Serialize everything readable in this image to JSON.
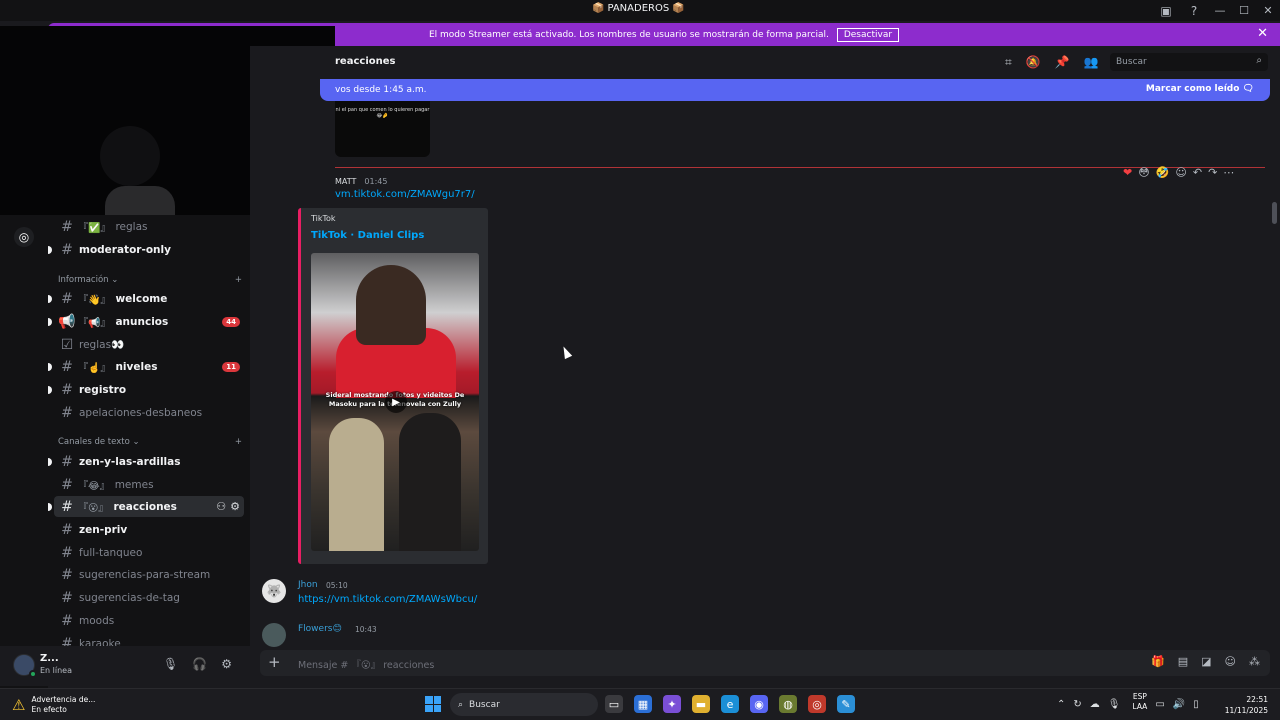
{
  "titlebar": {
    "server_name": "PANADEROS",
    "server_prefix": "📦",
    "server_suffix": "📦",
    "minimize": "—",
    "maximize": "☐",
    "close": "✕"
  },
  "streamer_banner": {
    "text": "El modo Streamer está activado. Los nombres de usuario se mostrarán de forma parcial.",
    "button": "Desactivar"
  },
  "sidebar": {
    "channels_top": [
      {
        "deco": "『✅』",
        "name": "reglas",
        "bold": false
      },
      {
        "deco": "",
        "name": "moderator-only",
        "bold": true
      }
    ],
    "category_info": "Información",
    "info_channels": [
      {
        "deco": "『👋』",
        "name": "welcome",
        "bold": true,
        "badge": ""
      },
      {
        "deco": "『📢』",
        "name": "anuncios",
        "bold": true,
        "badge": "44"
      },
      {
        "deco": "",
        "name": "reglas👀",
        "bold": false,
        "badge": ""
      },
      {
        "deco": "『☝️』",
        "name": "niveles",
        "bold": true,
        "badge": "11"
      },
      {
        "deco": "",
        "name": "registro",
        "bold": true,
        "badge": ""
      },
      {
        "deco": "",
        "name": "apelaciones-desbaneos",
        "bold": false,
        "badge": ""
      }
    ],
    "category_text": "Canales de texto",
    "text_channels": [
      {
        "deco": "",
        "name": "zen-y-las-ardillas",
        "bold": true
      },
      {
        "deco": "『😂』",
        "name": "memes",
        "bold": false
      },
      {
        "deco": "『😮』",
        "name": "reacciones",
        "bold": true,
        "active": true
      },
      {
        "deco": "",
        "name": "zen-priv",
        "bold": true
      },
      {
        "deco": "",
        "name": "full-tanqueo",
        "bold": false
      },
      {
        "deco": "",
        "name": "sugerencias-para-stream",
        "bold": false
      },
      {
        "deco": "",
        "name": "sugerencias-de-tag",
        "bold": false
      },
      {
        "deco": "",
        "name": "moods",
        "bold": false
      },
      {
        "deco": "",
        "name": "karaoke",
        "bold": false
      }
    ]
  },
  "user": {
    "name": "Z...",
    "status": "En línea"
  },
  "header": {
    "channel_title": "reacciones",
    "search_placeholder": "Buscar"
  },
  "new_messages": {
    "text": "vos desde 1:45 a.m.",
    "mark_read": "Marcar como leído"
  },
  "prev_image_caption": "ni el pan que comen lo quieren pagar 😂🤌",
  "message1": {
    "author": "MATT",
    "time": "01:45",
    "link": "vm.tiktok.com/ZMAWgu7r7/",
    "embed_provider": "TikTok",
    "embed_title": "TikTok · Daniel Clips",
    "thumb_caption": "Sideral mostrando fotos y videitos De Masoku para la telenovela con Zully"
  },
  "message2": {
    "author": "Jhon",
    "time": "05:10",
    "link": "https://vm.tiktok.com/ZMAWsWbcu/"
  },
  "message3": {
    "author": "Flowers😊",
    "time": "10:43"
  },
  "composer": {
    "placeholder": "Mensaje # 『😮』 reacciones"
  },
  "taskbar": {
    "warning_title": "Advertencia de...",
    "warning_sub": "En efecto",
    "search": "Buscar",
    "lang1": "ESP",
    "lang2": "LAA",
    "time": "22:51",
    "date": "11/11/2025"
  }
}
